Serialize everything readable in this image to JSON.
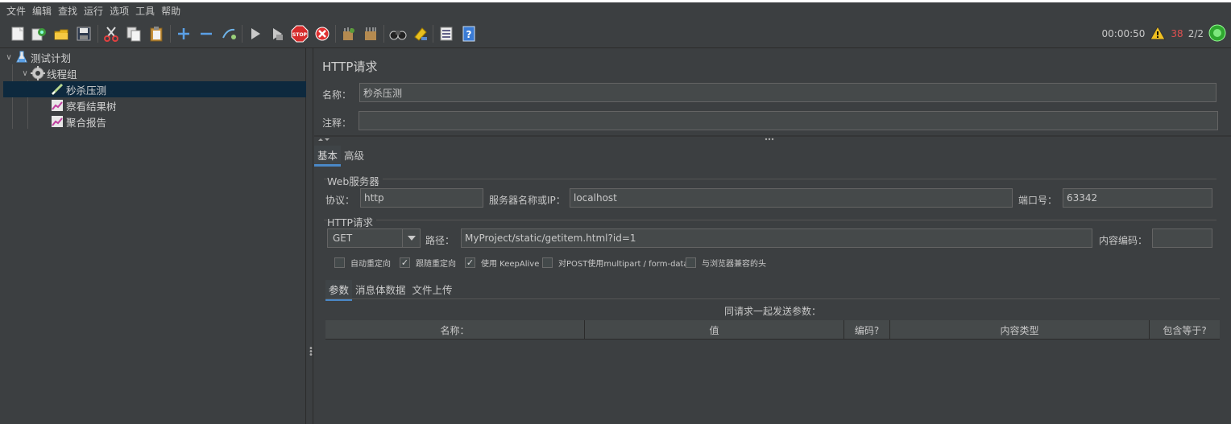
{
  "menu": [
    "文件",
    "编辑",
    "查找",
    "运行",
    "选项",
    "工具",
    "帮助"
  ],
  "toolbar": {
    "icons": [
      "new-icon",
      "templates-icon",
      "open-icon",
      "save-icon",
      "cut-icon",
      "copy-icon",
      "paste-icon",
      "expand-icon",
      "collapse-icon",
      "toggle-icon",
      "start-icon",
      "start-no-pause-icon",
      "stop-icon",
      "shutdown-icon",
      "clear-icon",
      "clear-all-icon",
      "search-icon",
      "reset-search-icon",
      "function-helper-icon",
      "help-icon"
    ],
    "timer": "00:00:50",
    "warning_count": "38",
    "threads": "2/2"
  },
  "tree": {
    "items": [
      {
        "label": "测试计划",
        "icon": "test-plan-icon"
      },
      {
        "label": "线程组",
        "icon": "thread-group-icon"
      },
      {
        "label": "秒杀压测",
        "icon": "http-sampler-icon"
      },
      {
        "label": "察看结果树",
        "icon": "listener-icon"
      },
      {
        "label": "聚合报告",
        "icon": "listener-icon"
      }
    ]
  },
  "panel": {
    "title": "HTTP请求",
    "name_label": "名称：",
    "name_value": "秒杀压测",
    "comment_label": "注释：",
    "comment_value": "",
    "tabs": [
      "基本",
      "高级"
    ],
    "web_server": {
      "title": "Web服务器",
      "protocol_label": "协议：",
      "protocol_value": "http",
      "server_label": "服务器名称或IP：",
      "server_value": "localhost",
      "port_label": "端口号：",
      "port_value": "63342"
    },
    "http_request": {
      "title": "HTTP请求",
      "method": "GET",
      "path_label": "路径：",
      "path_value": "MyProject/static/getitem.html?id=1",
      "encoding_label": "内容编码：",
      "encoding_value": ""
    },
    "checkboxes": [
      {
        "label": "自动重定向",
        "checked": false
      },
      {
        "label": "跟随重定向",
        "checked": true
      },
      {
        "label": "使用 KeepAlive",
        "checked": true
      },
      {
        "label": "对POST使用multipart / form-data",
        "checked": false
      },
      {
        "label": "与浏览器兼容的头",
        "checked": false
      }
    ],
    "sub_tabs": [
      "参数",
      "消息体数据",
      "文件上传"
    ],
    "table_caption": "同请求一起发送参数：",
    "columns": [
      "名称：",
      "值",
      "编码?",
      "内容类型",
      "包含等于?"
    ]
  }
}
